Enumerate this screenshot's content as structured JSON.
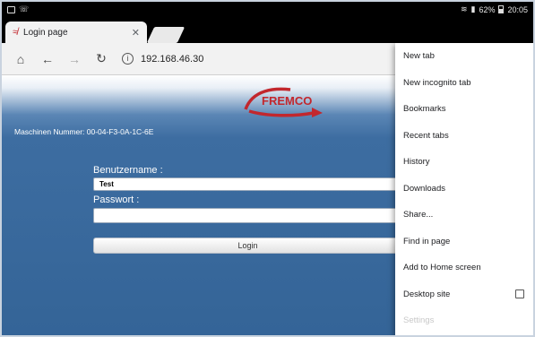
{
  "status_bar": {
    "battery_percent": "62%",
    "time": "20:05"
  },
  "tab": {
    "title": "Login page"
  },
  "toolbar": {
    "url": "192.168.46.30"
  },
  "page": {
    "logo_text": "FREMCO",
    "machine_number": "Maschinen Nummer: 00-04-F3-0A-1C-6E",
    "username_label": "Benutzername :",
    "username_value": "Test",
    "password_label": "Passwort :",
    "password_value": "",
    "login_label": "Login"
  },
  "menu": {
    "items": [
      {
        "label": "New tab"
      },
      {
        "label": "New incognito tab"
      },
      {
        "label": "Bookmarks"
      },
      {
        "label": "Recent tabs"
      },
      {
        "label": "History"
      },
      {
        "label": "Downloads"
      },
      {
        "label": "Share..."
      },
      {
        "label": "Find in page"
      },
      {
        "label": "Add to Home screen"
      },
      {
        "label": "Desktop site"
      },
      {
        "label": "Settings"
      }
    ],
    "desktop_site_checked": false
  },
  "colors": {
    "brand_red": "#c2272d",
    "page_blue": "#3d6da1"
  }
}
